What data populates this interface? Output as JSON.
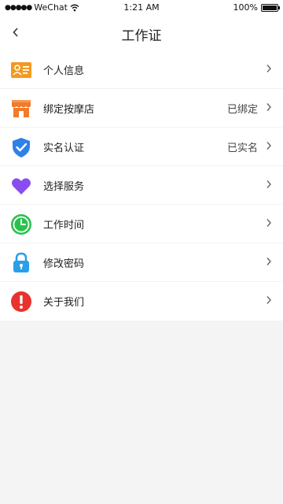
{
  "status_bar": {
    "signal": "●●●●●",
    "carrier": "WeChat",
    "time": "1:21 AM",
    "battery": "100%"
  },
  "nav": {
    "back_icon": "chevron-left-icon",
    "title": "工作证"
  },
  "menu": [
    {
      "label": "个人信息",
      "value": "",
      "icon": "id-card-icon",
      "color": "#f39a1f"
    },
    {
      "label": "绑定按摩店",
      "value": "已绑定",
      "icon": "store-icon",
      "color": "#f37a2a"
    },
    {
      "label": "实名认证",
      "value": "已实名",
      "icon": "shield-check-icon",
      "color": "#2f80e8"
    },
    {
      "label": "选择服务",
      "value": "",
      "icon": "heart-icon",
      "color": "#8a4cf0"
    },
    {
      "label": "工作时间",
      "value": "",
      "icon": "clock-icon",
      "color": "#27c24c"
    },
    {
      "label": "修改密码",
      "value": "",
      "icon": "lock-icon",
      "color": "#2a9ee8"
    },
    {
      "label": "关于我们",
      "value": "",
      "icon": "alert-icon",
      "color": "#e8322e"
    }
  ]
}
